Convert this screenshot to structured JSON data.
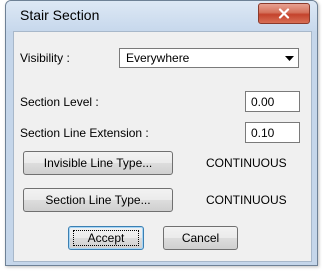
{
  "window": {
    "title": "Stair Section",
    "close_icon": "close-x-icon"
  },
  "visibility": {
    "label": "Visibility :",
    "selected": "Everywhere",
    "arrow_icon": "chevron-down-icon"
  },
  "section_level": {
    "label": "Section Level :",
    "value": "0.00"
  },
  "section_line_extension": {
    "label": "Section Line Extension :",
    "value": "0.10"
  },
  "invisible_line_type": {
    "button_label": "Invisible Line Type...",
    "value": "CONTINUOUS"
  },
  "section_line_type": {
    "button_label": "Section Line Type...",
    "value": "CONTINUOUS"
  },
  "actions": {
    "accept_label": "Accept",
    "cancel_label": "Cancel"
  }
}
